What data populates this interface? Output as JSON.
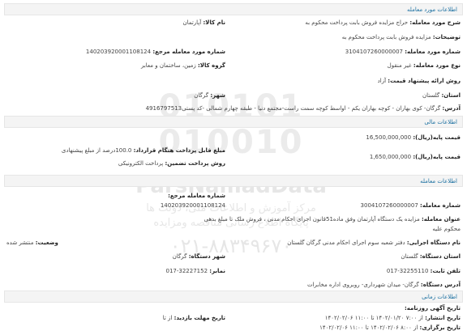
{
  "sections": {
    "deal_info": "اطلاعات مورد معامله",
    "financial": "اطلاعات مالی",
    "deal": "اطلاعات معامله",
    "timing": "اطلاعات زمانی"
  },
  "watermark": {
    "digits": "010101 010010",
    "brand": "ParsNamadData",
    "tag1": "مرکز آموزش و اطلاعات ملی، دولت ها",
    "tag2": "پایگاه اطلاع رسانی مناقصه ومزایده",
    "phone": "۰۲۱-۸۸۳۴۹۶۷۰"
  },
  "fields": {
    "title_lbl": "شرح مورد معامله:",
    "title_val": "حراج مزایده فروش بابت پرداخت محکوم به",
    "item_name_lbl": "نام کالا:",
    "item_name_val": "آپارتمان",
    "desc_lbl": "توضیحات:",
    "desc_val": "مزایده فروش بابت پرداخت محکوم به",
    "deal_no_lbl": "شماره مورد معامله:",
    "deal_no_val": "3104107260000007",
    "ref_no_lbl": "شماره مورد معامله مرجع:",
    "ref_no_val": "140203920001108124",
    "type_lbl": "نوع مورد معامله:",
    "type_val": "غیر منقول",
    "group_lbl": "گروه کالا:",
    "group_val": "زمین، ساختمان و معابر",
    "offer_lbl": "روش ارائه پیشنهاد قیمت:",
    "offer_val": "آزاد",
    "province_lbl": "استان:",
    "province_val": "گلستان",
    "city_lbl": "شهر:",
    "city_val": "گرگان",
    "address_lbl": "آدرس:",
    "address_val": "گرگان- کوی بهاران - کوچه بهاران یکم - اواسط کوچه سمت راست-مجتمع دنیا - طبقه چهارم شمالی -کد پستی4916797513"
  },
  "financial": {
    "base_price_lbl": "قیمت پایه(ریال):",
    "base_price_val": "16,500,000,000",
    "contract_lbl": "مبلغ قابل پرداخت هنگام قرارداد:",
    "contract_val": "100.0درصد از مبلغ پیشنهادی",
    "base_price2_lbl": "قیمت پایه(ریال):",
    "base_price2_val": "1,650,000,000",
    "guarantee_lbl": "روش پرداخت تضمین:",
    "guarantee_val": "پرداخت الکترونیکی"
  },
  "deal": {
    "ref_no_lbl": "شماره معامله مرجع:",
    "ref_no_val": "140203920001108124",
    "deal_no_lbl": "شماره معامله:",
    "deal_no_val": "3004107260000007",
    "title_lbl": "عنوان معامله:",
    "title_val": "مزایده یک دستگاه آپارتمان وفق ماده51قانون اجرای احکام مدنی ، فروش ملک تا مبلغ بدهی",
    "title_val2": "محکوم علیه",
    "status_lbl": "وضعیت:",
    "status_val": "منتشر شده",
    "org_lbl": "نام دستگاه اجرایی:",
    "org_val": "دفتر شعبه سوم اجرای احکام مدنی گرگان گلستان",
    "org_province_lbl": "استان دستگاه:",
    "org_province_val": "گلستان",
    "org_city_lbl": "شهر دستگاه:",
    "org_city_val": "گرگان",
    "phone_lbl": "تلفن ثابت:",
    "phone_val": "32255110-017",
    "fax_lbl": "نمابر:",
    "fax_val": "32227152-017",
    "addr_lbl": "آدرس دستگاه:",
    "addr_val": "گرگان- میدان شهرداری- روبروی اداره مخابرات"
  },
  "timing": {
    "ad_lbl": "تاریخ آگهی روزنامه:",
    "ad_val": "",
    "pub_lbl": "تاریخ انتشار:",
    "pub_val": "از ۷:۰۰ ۱۴۰۲/۰۱/۲۰ تا ۱۱:۰۰ ۱۴۰۲/۰۲/۰۶",
    "hold_lbl": "تاریخ برگزاری:",
    "hold_val": "از ۸:۰۰ ۱۴۰۲/۰۲/۰۶ تا ۱۱:۰۰ ۱۴۰۲/۰۲/۰۶",
    "visit_lbl": "تاریخ مهلت بازدید:",
    "visit_val": "از تا"
  }
}
